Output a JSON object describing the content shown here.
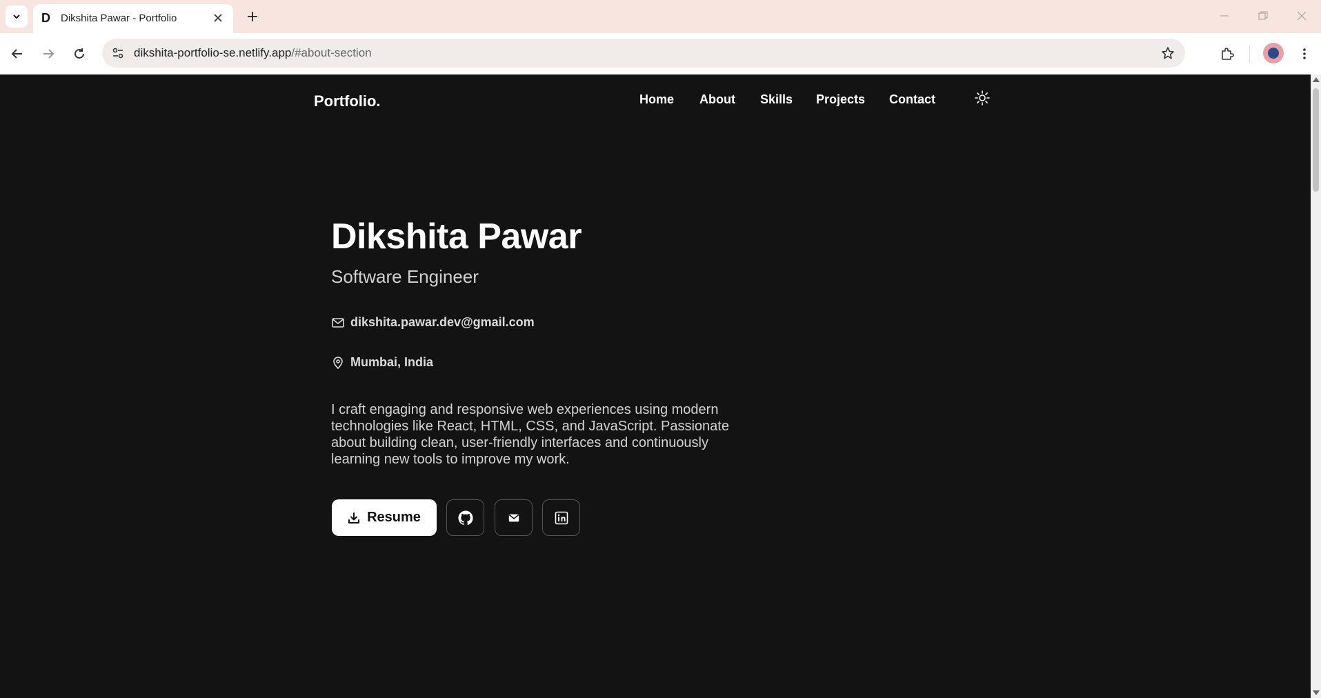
{
  "browser": {
    "tab_title": "Dikshita Pawar - Portfolio",
    "tab_favicon": "D",
    "url_host": "dikshita-portfolio-se.netlify.app",
    "url_path": "/#about-section"
  },
  "nav": {
    "brand": "Portfolio.",
    "items": [
      {
        "label": "Home"
      },
      {
        "label": "About"
      },
      {
        "label": "Skills"
      },
      {
        "label": "Projects"
      },
      {
        "label": "Contact"
      }
    ],
    "theme_icon": "sun-icon"
  },
  "hero": {
    "name": "Dikshita Pawar",
    "role": "Software Engineer",
    "email": "dikshita.pawar.dev@gmail.com",
    "location": "Mumbai, India",
    "description": "I craft engaging and responsive web experiences using modern technologies like React, HTML, CSS, and JavaScript. Passionate about building clean, user-friendly interfaces and continuously learning new tools to improve my work.",
    "resume_label": "Resume",
    "social_icons": [
      "github-icon",
      "mail-icon",
      "linkedin-icon"
    ]
  },
  "colors": {
    "page_background": "#131313",
    "tabbar_background": "#f9e5df",
    "text_primary": "#ffffff",
    "text_secondary": "#cfcfcf"
  }
}
